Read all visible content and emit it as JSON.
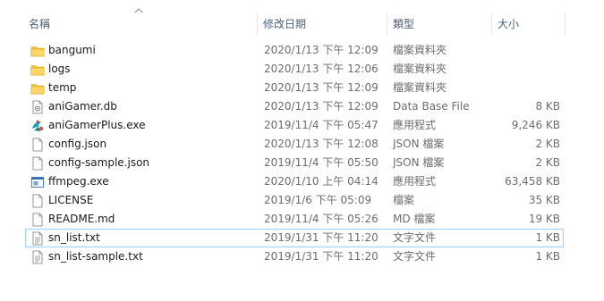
{
  "columns": {
    "name": "名稱",
    "date": "修改日期",
    "type": "類型",
    "size": "大小"
  },
  "colors": {
    "folder": "#f5c443",
    "header_text": "#4c607a",
    "focus_border": "#99d1ff",
    "secondary_text": "#6d6d6d"
  },
  "sort": {
    "column": "name",
    "direction": "ascending"
  },
  "files": [
    {
      "name": "bangumi",
      "date": "2020/1/13 下午 12:09",
      "type": "檔案資料夾",
      "size": "",
      "icon": "folder-icon"
    },
    {
      "name": "logs",
      "date": "2020/1/13 下午 12:06",
      "type": "檔案資料夾",
      "size": "",
      "icon": "folder-icon"
    },
    {
      "name": "temp",
      "date": "2020/1/13 下午 12:09",
      "type": "檔案資料夾",
      "size": "",
      "icon": "folder-icon"
    },
    {
      "name": "aniGamer.db",
      "date": "2020/1/13 下午 12:09",
      "type": "Data Base File",
      "size": "8 KB",
      "icon": "database-file-icon"
    },
    {
      "name": "aniGamerPlus.exe",
      "date": "2019/11/4 下午 05:47",
      "type": "應用程式",
      "size": "9,246 KB",
      "icon": "anigamer-app-icon"
    },
    {
      "name": "config.json",
      "date": "2020/1/13 下午 12:08",
      "type": "JSON 檔案",
      "size": "2 KB",
      "icon": "document-icon"
    },
    {
      "name": "config-sample.json",
      "date": "2019/11/4 下午 05:50",
      "type": "JSON 檔案",
      "size": "2 KB",
      "icon": "document-icon"
    },
    {
      "name": "ffmpeg.exe",
      "date": "2020/1/10 上午 04:14",
      "type": "應用程式",
      "size": "63,458 KB",
      "icon": "exe-app-icon"
    },
    {
      "name": "LICENSE",
      "date": "2019/1/6 下午 05:09",
      "type": "檔案",
      "size": "35 KB",
      "icon": "blank-file-icon"
    },
    {
      "name": "README.md",
      "date": "2019/11/4 下午 05:26",
      "type": "MD 檔案",
      "size": "19 KB",
      "icon": "blank-file-icon"
    },
    {
      "name": "sn_list.txt",
      "date": "2019/1/31 下午 11:20",
      "type": "文字文件",
      "size": "1 KB",
      "icon": "text-file-icon",
      "focused": true
    },
    {
      "name": "sn_list-sample.txt",
      "date": "2019/1/31 下午 11:20",
      "type": "文字文件",
      "size": "1 KB",
      "icon": "text-file-icon"
    }
  ]
}
